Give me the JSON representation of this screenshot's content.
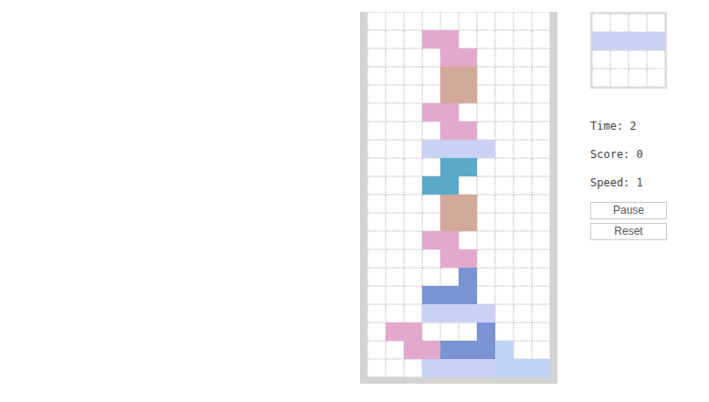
{
  "board": {
    "rows": [
      [
        "",
        "",
        "",
        "",
        "",
        "",
        "",
        "",
        "",
        ""
      ],
      [
        "",
        "",
        "",
        "#e3a9cd",
        "#e3a9cd",
        "",
        "",
        "",
        "",
        ""
      ],
      [
        "",
        "",
        "",
        "",
        "#e3a9cd",
        "#e3a9cd",
        "",
        "",
        "",
        ""
      ],
      [
        "",
        "",
        "",
        "",
        "#d3a99a",
        "#d3a99a",
        "",
        "",
        "",
        ""
      ],
      [
        "",
        "",
        "",
        "",
        "#d3a99a",
        "#d3a99a",
        "",
        "",
        "",
        ""
      ],
      [
        "",
        "",
        "",
        "#e3a9cd",
        "#e3a9cd",
        "",
        "",
        "",
        "",
        ""
      ],
      [
        "",
        "",
        "",
        "",
        "#e3a9cd",
        "#e3a9cd",
        "",
        "",
        "",
        ""
      ],
      [
        "",
        "",
        "",
        "#c9d1f4",
        "#c9d1f4",
        "#c9d1f4",
        "#c9d1f4",
        "",
        "",
        ""
      ],
      [
        "",
        "",
        "",
        "",
        "#5aa9c9",
        "#5aa9c9",
        "",
        "",
        "",
        ""
      ],
      [
        "",
        "",
        "",
        "#5aa9c9",
        "#5aa9c9",
        "",
        "",
        "",
        "",
        ""
      ],
      [
        "",
        "",
        "",
        "",
        "#d3a99a",
        "#d3a99a",
        "",
        "",
        "",
        ""
      ],
      [
        "",
        "",
        "",
        "",
        "#d3a99a",
        "#d3a99a",
        "",
        "",
        "",
        ""
      ],
      [
        "",
        "",
        "",
        "#e3a9cd",
        "#e3a9cd",
        "",
        "",
        "",
        "",
        ""
      ],
      [
        "",
        "",
        "",
        "",
        "#e3a9cd",
        "#e3a9cd",
        "",
        "",
        "",
        ""
      ],
      [
        "",
        "",
        "",
        "",
        "",
        "#7a93d3",
        "",
        "",
        "",
        ""
      ],
      [
        "",
        "",
        "",
        "#7a93d3",
        "#7a93d3",
        "#7a93d3",
        "",
        "",
        "",
        ""
      ],
      [
        "",
        "",
        "",
        "#c9d1f4",
        "#c9d1f4",
        "#c9d1f4",
        "#c9d1f4",
        "",
        "",
        ""
      ],
      [
        "",
        "#e3a9cd",
        "#e3a9cd",
        "",
        "",
        "",
        "#7a93d3",
        "",
        "",
        ""
      ],
      [
        "",
        "",
        "#e3a9cd",
        "#e3a9cd",
        "#7a93d3",
        "#7a93d3",
        "#7a93d3",
        "#bfd3f7",
        "",
        ""
      ],
      [
        "",
        "",
        "",
        "#c9d1f4",
        "#c9d1f4",
        "#c9d1f4",
        "#c9d1f4",
        "#bfd3f7",
        "#bfd3f7",
        "#bfd3f7"
      ]
    ]
  },
  "next": {
    "rows": [
      [
        "",
        "",
        "",
        ""
      ],
      [
        "#c9d1f4",
        "#c9d1f4",
        "#c9d1f4",
        "#c9d1f4"
      ],
      [
        "",
        "",
        "",
        ""
      ],
      [
        "",
        "",
        "",
        ""
      ]
    ]
  },
  "stats": [
    "Time: 2",
    "Score: 0",
    "Speed: 1"
  ],
  "buttons": [
    "Pause",
    "Reset"
  ]
}
